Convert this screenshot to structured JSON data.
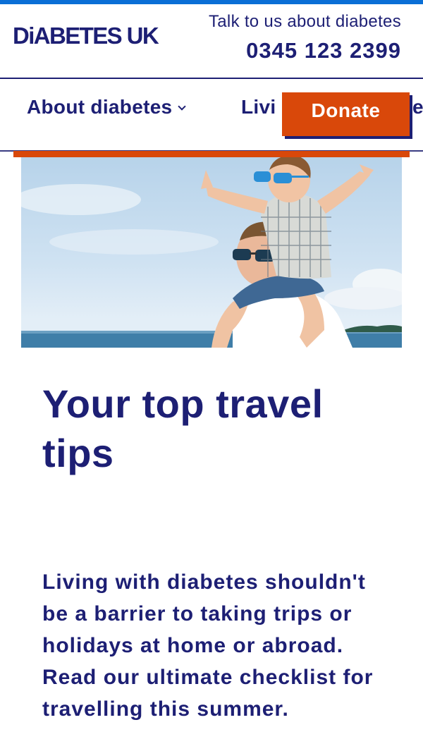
{
  "header": {
    "logo": "DiABETES UK",
    "talk_text": "Talk to us about diabetes",
    "phone": "0345 123 2399"
  },
  "nav": {
    "items": [
      {
        "label": "About diabetes",
        "has_dropdown": true
      },
      {
        "label": "Livi"
      }
    ],
    "overflow_fragment": "e"
  },
  "donate": {
    "label": "Donate"
  },
  "hero": {
    "icon": "hero-image"
  },
  "article": {
    "title": "Your top travel tips",
    "intro": "Living with diabetes shouldn't be a barrier to taking trips or holidays at home or abroad. Read our ultimate checklist for travelling this summer."
  },
  "colors": {
    "navy": "#1d1f74",
    "orange": "#d9480a",
    "blue_stripe": "#0a6fd6"
  }
}
